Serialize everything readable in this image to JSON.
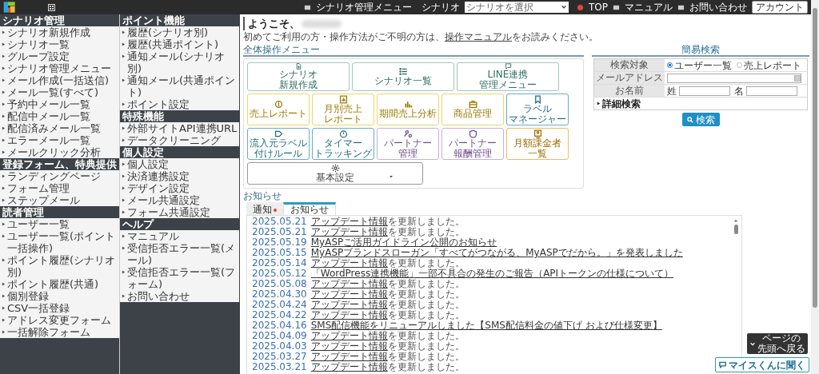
{
  "header": {
    "links": [
      "TOP",
      "マニュアル",
      "お問い合わせ"
    ],
    "account_button": "アカウント",
    "menu_link": "シナリオ管理メニュー",
    "scenario_label": "シナリオ",
    "scenario_select": "シナリオを選択"
  },
  "sidebar": [
    {
      "title": "シナリオ管理",
      "items": [
        "シナリオ新規作成",
        "シナリオ一覧",
        "グループ設定",
        "シナリオ管理メニュー",
        "メール作成(一括送信)",
        "メール一覧(すべて)",
        "予約中メール一覧",
        "配信中メール一覧",
        "配信済みメール一覧",
        "エラーメール一覧",
        "メールクリック分析"
      ]
    },
    {
      "title": "登録フォーム、特典提供",
      "items": [
        "ランディングページ",
        "フォーム管理",
        "ステップメール"
      ]
    },
    {
      "title": "読者管理",
      "items": [
        "ユーザー一覧",
        "ユーザー一覧(ポイント一括操作)",
        "ポイント履歴(シナリオ別)",
        "ポイント履歴(共通)",
        "個別登録",
        "CSV一括登録",
        "アドレス変更フォーム",
        "一括解除フォーム"
      ]
    },
    {
      "title": "ポイント機能",
      "items": [
        "履歴(シナリオ別)",
        "履歴(共通ポイント)",
        "通知メール(シナリオ別)",
        "通知メール(共通ポイント)",
        "ポイント設定"
      ]
    },
    {
      "title": "特殊機能",
      "items": [
        "外部サイトAPI連携URL",
        "データクリーニング"
      ]
    },
    {
      "title": "個人設定",
      "items": [
        "個人設定",
        "決済連携設定",
        "デザイン設定",
        "メール共通設定",
        "フォーム共通設定"
      ]
    },
    {
      "title": "ヘルプ",
      "items": [
        "マニュアル",
        "受信拒否エラー一覧(メール)",
        "受信拒否エラー一覧(フォーム)",
        "お問い合わせ"
      ]
    }
  ],
  "welcome": {
    "greeting": "ようこそ、",
    "note_before": "初めてご利用の方・操作方法がご不明の方は、",
    "note_link": "操作マニュアル",
    "note_after": "をお読みください。"
  },
  "quick_search": {
    "title": "簡易検索",
    "target_label": "検索対象",
    "targets": [
      {
        "label": "ユーザー一覧",
        "selected": true
      },
      {
        "label": "売上レポート",
        "selected": false
      }
    ],
    "email_label": "メールアドレス",
    "name_label": "お名前",
    "last_name_label": "姓",
    "first_name_label": "名",
    "advanced": "詳細検索",
    "button": "検索"
  },
  "menu": {
    "title": "全体操作メニュー",
    "scenario_tiles": [
      {
        "lines": [
          "シナリオ",
          "新規作成"
        ],
        "kind": "scenario"
      },
      {
        "lines": [
          "シナリオ一覧"
        ],
        "kind": "scenario"
      },
      {
        "lines": [
          "LINE連携",
          "管理メニュー"
        ],
        "kind": "scenario"
      }
    ],
    "function_tiles": [
      {
        "lines": [
          "売上レポート"
        ],
        "kind": "sales"
      },
      {
        "lines": [
          "月別売上",
          "レポート"
        ],
        "kind": "sales"
      },
      {
        "lines": [
          "期間売上分析"
        ],
        "kind": "sales"
      },
      {
        "lines": [
          "商品管理"
        ],
        "kind": "sales"
      },
      {
        "lines": [
          "ラベル",
          "マネージャー"
        ],
        "kind": "label"
      },
      {
        "lines": [
          "流入元ラベル",
          "付けルール"
        ],
        "kind": "label"
      },
      {
        "lines": [
          "タイマー",
          "トラッキング"
        ],
        "kind": "label"
      },
      {
        "lines": [
          "パートナー",
          "管理"
        ],
        "kind": "partner"
      },
      {
        "lines": [
          "パートナー",
          "報酬管理"
        ],
        "kind": "partner"
      },
      {
        "lines": [
          "月額課金者",
          "一覧"
        ],
        "kind": "billing"
      }
    ],
    "settings_tile": {
      "lines": [
        "基本設定"
      ],
      "kind": "settings"
    }
  },
  "news": {
    "title": "お知らせ",
    "tabs": [
      {
        "label": "通知",
        "selected": false,
        "unread": true
      },
      {
        "label": "お知らせ",
        "selected": true,
        "unread": false
      }
    ],
    "items": [
      {
        "date": "2025.05.21",
        "link": "アップデート情報",
        "rest": "を更新しました。"
      },
      {
        "date": "2025.05.21",
        "link": "アップデート情報",
        "rest": "を更新しました。"
      },
      {
        "date": "2025.05.19",
        "link": "MyASPご活用ガイドライン公開のお知らせ"
      },
      {
        "date": "2025.05.15",
        "link": "MyASPブランドスローガン「すべてがつながる、MyASPでだから。」を発表しました"
      },
      {
        "date": "2025.05.14",
        "link": "アップデート情報",
        "rest": "を更新しました。"
      },
      {
        "date": "2025.05.12",
        "link": "「WordPress連携機能」一部不具合の発生のご報告（APIトークンの仕様について）"
      },
      {
        "date": "2025.05.08",
        "link": "アップデート情報",
        "rest": "を更新しました。"
      },
      {
        "date": "2025.04.30",
        "link": "アップデート情報",
        "rest": "を更新しました。"
      },
      {
        "date": "2025.04.24",
        "link": "アップデート情報",
        "rest": "を更新しました。"
      },
      {
        "date": "2025.04.22",
        "link": "アップデート情報",
        "rest": "を更新しました。"
      },
      {
        "date": "2025.04.16",
        "link": "SMS配信機能をリニューアルしました【SMS配信料金の値下げ および仕様変更】"
      },
      {
        "date": "2025.04.09",
        "link": "アップデート情報",
        "rest": "を更新しました。"
      },
      {
        "date": "2025.04.03",
        "link": "アップデート情報",
        "rest": "を更新しました。"
      },
      {
        "date": "2025.03.27",
        "link": "アップデート情報",
        "rest": "を更新しました。"
      },
      {
        "date": "2025.03.21",
        "link": "アップデート情報",
        "rest": "を更新しました。"
      }
    ]
  },
  "page_top_button": [
    "ページの",
    "先頭へ戻る"
  ],
  "chat_button": "マイスくんに聞く"
}
